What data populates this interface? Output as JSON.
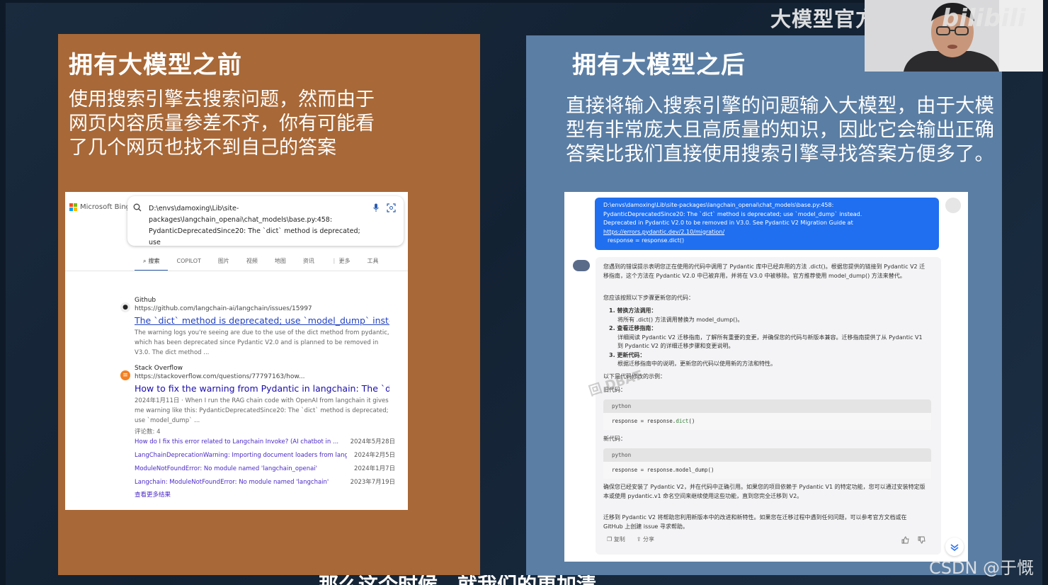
{
  "overlay": {
    "channel_title": "大模型官方课程",
    "platform_logo": "bilibili",
    "csdn_watermark": "CSDN @于慨",
    "subtitle": "那么这个时候，就我们的更加清"
  },
  "left_panel": {
    "title": "拥有大模型之前",
    "desc_lines": [
      "使用搜索引擎去搜索问题，然而由于",
      "网页内容质量参差不齐，你有可能看",
      "了几个网页也找不到自己的答案"
    ],
    "bing": {
      "logo_text": "Microsoft Bing",
      "query_lines": [
        "D:\\envs\\damoxing\\Lib\\site-",
        "packages\\langchain_openai\\chat_models\\base.py:458:",
        "PydanticDeprecatedSince20: The `dict` method is deprecated; use"
      ],
      "tabs": [
        "搜索",
        "COPILOT",
        "图片",
        "视频",
        "地图",
        "资讯",
        "⋮ 更多",
        "工具"
      ],
      "results": [
        {
          "site": "Github",
          "url": "https://github.com/langchain-ai/langchain/issues/15997",
          "title": "The `dict` method is deprecated; use `model_dump` instead ...",
          "snippet": "The warning logs you're seeing are due to the use of the dict method from pydantic, which has been deprecated since Pydantic V2.0 and is planned to be removed in V3.0. The dict method ..."
        },
        {
          "site": "Stack Overflow",
          "url": "https://stackoverflow.com/questions/77797163/how...",
          "title": "How to fix the warning from Pydantic in langchain: The `dict` ...",
          "snippet": "2024年1月11日 · When I run the RAG chain code with OpenAI from langchain it gives me warning like this: PydanticDeprecatedSince20: The `dict` method is deprecated; use `model_dump` ...",
          "meta": "评论数: 4"
        }
      ],
      "related": [
        {
          "title": "How do I fix this error related to Langchain Invoke? (AI chatbot in ...",
          "date": "2024年5月28日"
        },
        {
          "title": "LangChainDeprecationWarning: Importing document loaders from langchain ...",
          "date": "2024年2月5日"
        },
        {
          "title": "ModuleNotFoundError: No module named 'langchain_openai'",
          "date": "2024年1月7日"
        },
        {
          "title": "Langchain: ModuleNotFoundError: No module named 'langchain'",
          "date": "2023年7月19日"
        }
      ],
      "see_more": "查看更多结果"
    }
  },
  "right_panel": {
    "title": "拥有大模型之后",
    "desc_lines": [
      "直接将输入搜索引擎的问题输入大模型，由于大模",
      "型有非常庞大且高质量的知识，因此它会输出正确",
      "答案比我们直接使用搜索引擎寻找答案方便多了。"
    ],
    "chat": {
      "user_lines": [
        "D:\\envs\\damoxing\\Lib\\site-packages\\langchain_openai\\chat_models\\base.py:458:",
        "PydanticDeprecatedSince20: The `dict` method is deprecated; use `model_dump` instead.",
        "Deprecated in Pydantic V2.0 to be removed in V3.0. See Pydantic V2 Migration Guide at"
      ],
      "user_link": "https://errors.pydantic.dev/2.10/migration/",
      "user_code": "response = response.dict()",
      "bot_intro": "您遇到的错误提示表明您正在使用的代码中调用了 Pydantic 库中已经弃用的方法 .dict()。根据您提供的链接到 Pydantic V2 迁移指南，这个方法在 Pydantic V2.0 中已被弃用，并将在 V3.0 中被移除。官方推荐使用 model_dump() 方法来替代。",
      "bot_steps_intro": "您应该按照以下步骤更新您的代码：",
      "steps": [
        {
          "head": "1. 替换方法调用：",
          "body": "将所有 .dict() 方法调用替换为 model_dump()。"
        },
        {
          "head": "2. 查看迁移指南：",
          "body": "详细阅读 Pydantic V2 迁移指南，了解所有重要的变更，并确保您的代码与新版本兼容。迁移指南提供了从 Pydantic V1 到 Pydantic V2 的详细迁移步骤和变更说明。"
        },
        {
          "head": "3. 更新代码：",
          "body": "根据迁移指南中的说明，更新您的代码以使用新的方法和特性。"
        }
      ],
      "example_intro": "以下是代码修改的示例：",
      "old_label": "旧代码：",
      "new_label": "新代码：",
      "code_lang": "python",
      "old_code_lhs": "response = response.",
      "old_code_fn": "dict",
      "old_code_rhs": "()",
      "new_code": "response = response.model_dump()",
      "closing1": "确保您已经安装了 Pydantic V2，并在代码中正确引用。如果您的项目依赖于 Pydantic V1 的特定功能，您可以通过安装特定版本或使用 pydantic.v1 命名空间来继续使用这些功能，直到您完全迁移到 V2。",
      "closing2": "迁移到 Pydantic V2 将帮助您利用新版本中的改进和新特性。如果您在迁移过程中遇到任何问题，可以参考官方文档或在 GitHub 上创建 issue 寻求帮助。",
      "copy_label": "复制",
      "share_label": "分享"
    }
  },
  "colors": {
    "left_panel": "#a86837",
    "right_panel": "#5b7ea4",
    "user_bubble": "#1f6ff0",
    "link": "#1a0dab"
  }
}
